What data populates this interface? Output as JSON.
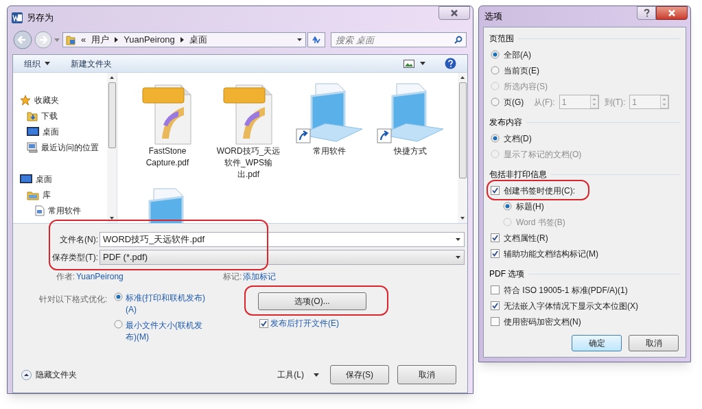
{
  "save_dialog": {
    "title": "另存为",
    "address": [
      "«",
      "用户",
      "YuanPeirong",
      "桌面"
    ],
    "search": {
      "placeholder": "搜索 桌面"
    },
    "toolbar": {
      "organize": "组织",
      "new_folder": "新建文件夹"
    },
    "nav": [
      {
        "label": "收藏夹",
        "kind": "star",
        "children": [
          {
            "label": "下载",
            "kind": "download"
          },
          {
            "label": "桌面",
            "kind": "desktop"
          },
          {
            "label": "最近访问的位置",
            "kind": "recent"
          }
        ]
      },
      {
        "label": "桌面",
        "kind": "desktop",
        "children": [
          {
            "label": "库",
            "kind": "library",
            "children": [
              {
                "label": "常用软件",
                "kind": "doc"
              }
            ]
          }
        ]
      }
    ],
    "files": [
      {
        "name": "FastStone Capture.pdf",
        "kind": "pdf"
      },
      {
        "name": "WORD技巧_天远软件_WPS输出.pdf",
        "kind": "pdf"
      },
      {
        "name": "常用软件",
        "kind": "shortcut"
      },
      {
        "name": "快捷方式",
        "kind": "shortcut"
      },
      {
        "kind": "document"
      }
    ],
    "fields_highlighted": true,
    "file_name": {
      "label": "文件名(N):",
      "value": "WORD技巧_天远软件.pdf"
    },
    "file_type": {
      "label": "保存类型(T):",
      "value": "PDF (*.pdf)"
    },
    "author": {
      "label": "作者:",
      "value": "YuanPeirong"
    },
    "tags": {
      "label": "标记:",
      "value": "添加标记"
    },
    "optimize": {
      "label": "针对以下格式优化:",
      "options": [
        {
          "label": "标准(打印和联机发布)(A)",
          "selected": true
        },
        {
          "label": "最小文件大小(联机发布)(M)",
          "selected": false
        }
      ]
    },
    "options_button": {
      "label": "选项(O)...",
      "highlighted": true
    },
    "open_after": {
      "label": "发布后打开文件(E)",
      "checked": true
    },
    "hide_folders": "隐藏文件夹",
    "tools": "工具(L)",
    "save": "保存(S)",
    "cancel": "取消"
  },
  "options_dialog": {
    "title": "选项",
    "sections": [
      {
        "title": "页范围",
        "items": [
          {
            "kind": "radio",
            "label": "全部(A)",
            "selected": true,
            "disabled": false
          },
          {
            "kind": "radio",
            "label": "当前页(E)",
            "selected": false,
            "disabled": false
          },
          {
            "kind": "radio",
            "label": "所选内容(S)",
            "selected": false,
            "disabled": true
          },
          {
            "kind": "range",
            "label": "页(G)",
            "selected": false,
            "disabled": false,
            "from_label": "从(F):",
            "from": "1",
            "to_label": "到(T):",
            "to": "1"
          }
        ]
      },
      {
        "title": "发布内容",
        "items": [
          {
            "kind": "radio",
            "label": "文档(D)",
            "selected": true,
            "disabled": false
          },
          {
            "kind": "radio",
            "label": "显示了标记的文档(O)",
            "selected": false,
            "disabled": true
          }
        ]
      },
      {
        "title": "包括非打印信息",
        "items": [
          {
            "kind": "checkbox",
            "label": "创建书签时使用(C):",
            "checked": true,
            "highlighted": true,
            "children": [
              {
                "kind": "radio",
                "label": "标题(H)",
                "selected": true,
                "disabled": false
              },
              {
                "kind": "radio",
                "label": "Word 书签(B)",
                "selected": false,
                "disabled": true
              }
            ]
          },
          {
            "kind": "checkbox",
            "label": "文档属性(R)",
            "checked": true,
            "highlighted": false
          },
          {
            "kind": "checkbox",
            "label": "辅助功能文档结构标记(M)",
            "checked": true,
            "highlighted": false
          }
        ]
      },
      {
        "title": "PDF 选项",
        "items": [
          {
            "kind": "checkbox",
            "label": "符合 ISO 19005-1 标准(PDF/A)(1)",
            "checked": false,
            "highlighted": false
          },
          {
            "kind": "checkbox",
            "label": "无法嵌入字体情况下显示文本位图(X)",
            "checked": true,
            "highlighted": false
          },
          {
            "kind": "checkbox",
            "label": "使用密码加密文档(N)",
            "checked": false,
            "highlighted": false
          }
        ]
      }
    ],
    "ok": "确定",
    "cancel": "取消"
  }
}
